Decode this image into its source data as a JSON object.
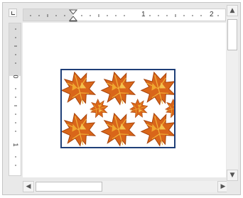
{
  "horizontal_ruler": {
    "labels": [
      "1",
      "2"
    ]
  },
  "vertical_ruler": {
    "labels": [
      "0",
      "1"
    ]
  },
  "image": {
    "description_icon": "maple-leaf-pattern"
  },
  "scrollbars": {
    "up_arrow": "▲",
    "down_arrow": "▼",
    "left_arrow": "◀",
    "right_arrow": "▶"
  }
}
